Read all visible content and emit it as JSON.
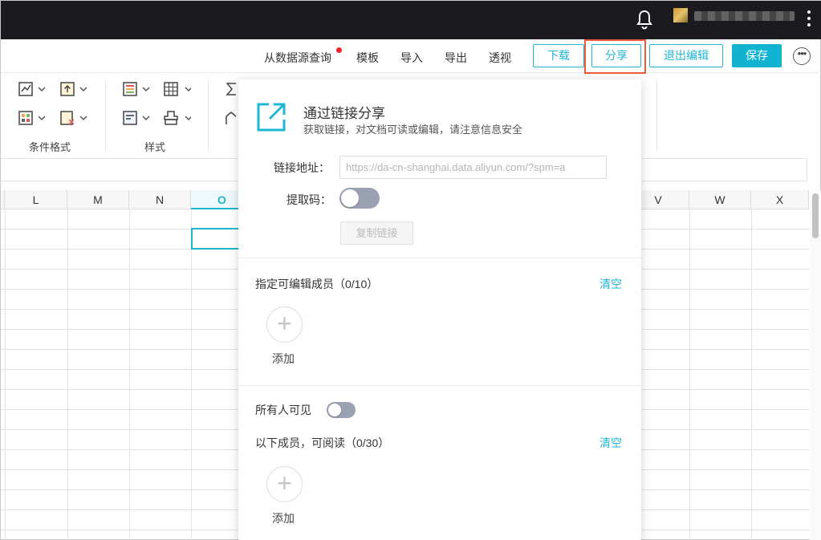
{
  "topbar": {
    "bell_icon": "bell-icon",
    "avatar_icon": "avatar",
    "more_icon": "kebab-menu-icon"
  },
  "toolbar": {
    "query_datasource": "从数据源查询",
    "template": "模板",
    "import": "导入",
    "export": "导出",
    "pivot": "透视",
    "download": "下载",
    "share": "分享",
    "exit_edit": "退出编辑",
    "save": "保存"
  },
  "ribbon": {
    "group1_label": "条件格式",
    "group2_label": "样式"
  },
  "columns": [
    "L",
    "M",
    "N",
    "O",
    "V",
    "W",
    "X"
  ],
  "active_column": "O",
  "share_panel": {
    "title": "通过链接分享",
    "subtitle": "获取链接，对文档可读或编辑，请注意信息安全",
    "link_label": "链接地址：",
    "link_value": "https://da-cn-shanghai.data.aliyun.com/?spm=a",
    "code_label": "提取码：",
    "code_enabled": false,
    "copy_link": "复制链接",
    "editors_label": "指定可编辑成员（0/10）",
    "clear1": "清空",
    "add1": "添加",
    "everyone_visible": "所有人可见",
    "everyone_enabled": false,
    "readers_label": "以下成员，可阅读（0/30）",
    "clear2": "清空",
    "add2": "添加"
  },
  "colors": {
    "accent": "#1fb6d2",
    "highlight": "#ef5b3a",
    "notify": "#f5222d"
  }
}
